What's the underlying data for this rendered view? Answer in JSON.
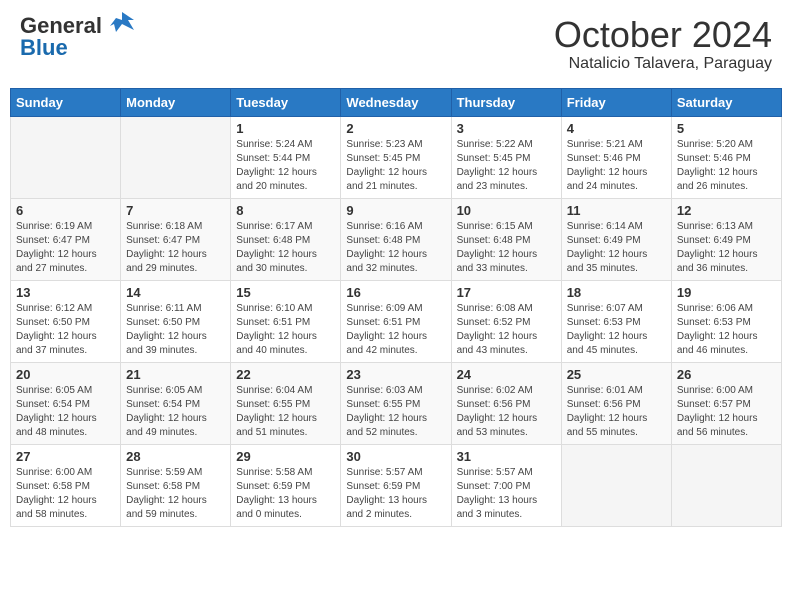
{
  "header": {
    "logo_general": "General",
    "logo_blue": "Blue",
    "month": "October 2024",
    "location": "Natalicio Talavera, Paraguay"
  },
  "weekdays": [
    "Sunday",
    "Monday",
    "Tuesday",
    "Wednesday",
    "Thursday",
    "Friday",
    "Saturday"
  ],
  "weeks": [
    [
      {
        "day": "",
        "sunrise": "",
        "sunset": "",
        "daylight": ""
      },
      {
        "day": "",
        "sunrise": "",
        "sunset": "",
        "daylight": ""
      },
      {
        "day": "1",
        "sunrise": "Sunrise: 5:24 AM",
        "sunset": "Sunset: 5:44 PM",
        "daylight": "Daylight: 12 hours and 20 minutes."
      },
      {
        "day": "2",
        "sunrise": "Sunrise: 5:23 AM",
        "sunset": "Sunset: 5:45 PM",
        "daylight": "Daylight: 12 hours and 21 minutes."
      },
      {
        "day": "3",
        "sunrise": "Sunrise: 5:22 AM",
        "sunset": "Sunset: 5:45 PM",
        "daylight": "Daylight: 12 hours and 23 minutes."
      },
      {
        "day": "4",
        "sunrise": "Sunrise: 5:21 AM",
        "sunset": "Sunset: 5:46 PM",
        "daylight": "Daylight: 12 hours and 24 minutes."
      },
      {
        "day": "5",
        "sunrise": "Sunrise: 5:20 AM",
        "sunset": "Sunset: 5:46 PM",
        "daylight": "Daylight: 12 hours and 26 minutes."
      }
    ],
    [
      {
        "day": "6",
        "sunrise": "Sunrise: 6:19 AM",
        "sunset": "Sunset: 6:47 PM",
        "daylight": "Daylight: 12 hours and 27 minutes."
      },
      {
        "day": "7",
        "sunrise": "Sunrise: 6:18 AM",
        "sunset": "Sunset: 6:47 PM",
        "daylight": "Daylight: 12 hours and 29 minutes."
      },
      {
        "day": "8",
        "sunrise": "Sunrise: 6:17 AM",
        "sunset": "Sunset: 6:48 PM",
        "daylight": "Daylight: 12 hours and 30 minutes."
      },
      {
        "day": "9",
        "sunrise": "Sunrise: 6:16 AM",
        "sunset": "Sunset: 6:48 PM",
        "daylight": "Daylight: 12 hours and 32 minutes."
      },
      {
        "day": "10",
        "sunrise": "Sunrise: 6:15 AM",
        "sunset": "Sunset: 6:48 PM",
        "daylight": "Daylight: 12 hours and 33 minutes."
      },
      {
        "day": "11",
        "sunrise": "Sunrise: 6:14 AM",
        "sunset": "Sunset: 6:49 PM",
        "daylight": "Daylight: 12 hours and 35 minutes."
      },
      {
        "day": "12",
        "sunrise": "Sunrise: 6:13 AM",
        "sunset": "Sunset: 6:49 PM",
        "daylight": "Daylight: 12 hours and 36 minutes."
      }
    ],
    [
      {
        "day": "13",
        "sunrise": "Sunrise: 6:12 AM",
        "sunset": "Sunset: 6:50 PM",
        "daylight": "Daylight: 12 hours and 37 minutes."
      },
      {
        "day": "14",
        "sunrise": "Sunrise: 6:11 AM",
        "sunset": "Sunset: 6:50 PM",
        "daylight": "Daylight: 12 hours and 39 minutes."
      },
      {
        "day": "15",
        "sunrise": "Sunrise: 6:10 AM",
        "sunset": "Sunset: 6:51 PM",
        "daylight": "Daylight: 12 hours and 40 minutes."
      },
      {
        "day": "16",
        "sunrise": "Sunrise: 6:09 AM",
        "sunset": "Sunset: 6:51 PM",
        "daylight": "Daylight: 12 hours and 42 minutes."
      },
      {
        "day": "17",
        "sunrise": "Sunrise: 6:08 AM",
        "sunset": "Sunset: 6:52 PM",
        "daylight": "Daylight: 12 hours and 43 minutes."
      },
      {
        "day": "18",
        "sunrise": "Sunrise: 6:07 AM",
        "sunset": "Sunset: 6:53 PM",
        "daylight": "Daylight: 12 hours and 45 minutes."
      },
      {
        "day": "19",
        "sunrise": "Sunrise: 6:06 AM",
        "sunset": "Sunset: 6:53 PM",
        "daylight": "Daylight: 12 hours and 46 minutes."
      }
    ],
    [
      {
        "day": "20",
        "sunrise": "Sunrise: 6:05 AM",
        "sunset": "Sunset: 6:54 PM",
        "daylight": "Daylight: 12 hours and 48 minutes."
      },
      {
        "day": "21",
        "sunrise": "Sunrise: 6:05 AM",
        "sunset": "Sunset: 6:54 PM",
        "daylight": "Daylight: 12 hours and 49 minutes."
      },
      {
        "day": "22",
        "sunrise": "Sunrise: 6:04 AM",
        "sunset": "Sunset: 6:55 PM",
        "daylight": "Daylight: 12 hours and 51 minutes."
      },
      {
        "day": "23",
        "sunrise": "Sunrise: 6:03 AM",
        "sunset": "Sunset: 6:55 PM",
        "daylight": "Daylight: 12 hours and 52 minutes."
      },
      {
        "day": "24",
        "sunrise": "Sunrise: 6:02 AM",
        "sunset": "Sunset: 6:56 PM",
        "daylight": "Daylight: 12 hours and 53 minutes."
      },
      {
        "day": "25",
        "sunrise": "Sunrise: 6:01 AM",
        "sunset": "Sunset: 6:56 PM",
        "daylight": "Daylight: 12 hours and 55 minutes."
      },
      {
        "day": "26",
        "sunrise": "Sunrise: 6:00 AM",
        "sunset": "Sunset: 6:57 PM",
        "daylight": "Daylight: 12 hours and 56 minutes."
      }
    ],
    [
      {
        "day": "27",
        "sunrise": "Sunrise: 6:00 AM",
        "sunset": "Sunset: 6:58 PM",
        "daylight": "Daylight: 12 hours and 58 minutes."
      },
      {
        "day": "28",
        "sunrise": "Sunrise: 5:59 AM",
        "sunset": "Sunset: 6:58 PM",
        "daylight": "Daylight: 12 hours and 59 minutes."
      },
      {
        "day": "29",
        "sunrise": "Sunrise: 5:58 AM",
        "sunset": "Sunset: 6:59 PM",
        "daylight": "Daylight: 13 hours and 0 minutes."
      },
      {
        "day": "30",
        "sunrise": "Sunrise: 5:57 AM",
        "sunset": "Sunset: 6:59 PM",
        "daylight": "Daylight: 13 hours and 2 minutes."
      },
      {
        "day": "31",
        "sunrise": "Sunrise: 5:57 AM",
        "sunset": "Sunset: 7:00 PM",
        "daylight": "Daylight: 13 hours and 3 minutes."
      },
      {
        "day": "",
        "sunrise": "",
        "sunset": "",
        "daylight": ""
      },
      {
        "day": "",
        "sunrise": "",
        "sunset": "",
        "daylight": ""
      }
    ]
  ]
}
